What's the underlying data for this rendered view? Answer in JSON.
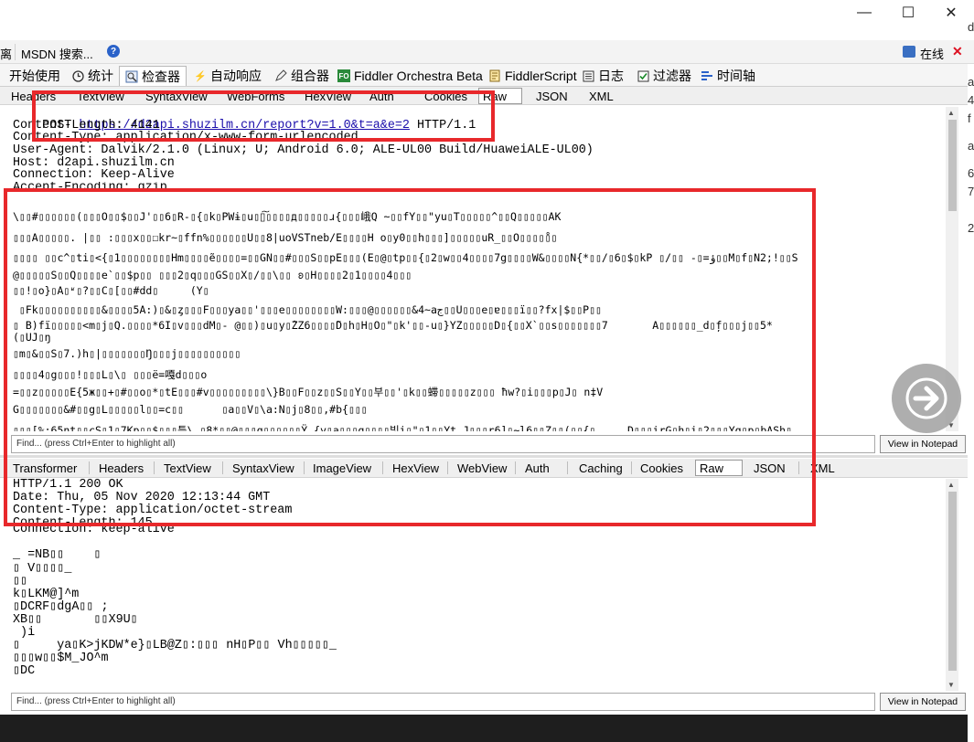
{
  "toolbar_top": {
    "left_label_1": "离",
    "search_label": "MSDN 搜索...",
    "help_icon": "help-circle-icon",
    "online_label": "在线",
    "close_x": "✕"
  },
  "window_controls": {
    "minimize": "—",
    "maximize": "☐",
    "close": "✕"
  },
  "right_edge_glyphs": [
    "d",
    "8",
    "a",
    "4",
    "f",
    "a",
    "6",
    "7",
    "2"
  ],
  "main_tabs": [
    {
      "label": "开始使用",
      "icon": ""
    },
    {
      "label": "统计",
      "icon": "clock-icon"
    },
    {
      "label": "检查器",
      "icon": "inspector-icon"
    },
    {
      "label": "自动响应",
      "icon": "lightning-icon"
    },
    {
      "label": "组合器",
      "icon": "compose-icon"
    },
    {
      "label": "Fiddler Orchestra Beta",
      "icon": "fo-icon"
    },
    {
      "label": "FiddlerScript",
      "icon": "script-icon"
    },
    {
      "label": "日志",
      "icon": "log-icon"
    },
    {
      "label": "过滤器",
      "icon": "filter-icon"
    },
    {
      "label": "时间轴",
      "icon": "timeline-icon"
    }
  ],
  "request_tabs": [
    "Headers",
    "TextView",
    "SyntaxView",
    "WebForms",
    "HexView",
    "Auth",
    "Cookies",
    "Raw",
    "JSON",
    "XML"
  ],
  "request_selected": "Raw",
  "request_headers": [
    {
      "prefix": "POST ",
      "url": "https://d2api.shuzilm.cn/report?v=1.0&t=a&e=2",
      "suffix": " HTTP/1.1"
    },
    {
      "text": "Content-Length: 4141"
    },
    {
      "text": "Content-Type: application/x-www-form-urlencoded"
    },
    {
      "text": "User-Agent: Dalvik/2.1.0 (Linux; U; Android 6.0; ALE-UL00 Build/HuaweiALE-UL00)"
    },
    {
      "text": "Host: d2api.shuzilm.cn"
    },
    {
      "text": "Connection: Keep-Alive"
    },
    {
      "text": "Accept-Encoding: gzip"
    }
  ],
  "request_body": [
    "\\▯▯#▯▯▯▯▯▯(▯▯▯O▯▯$▯▯J'▯▯6▯R-▯{▯k▯PWɨ▯u▯▯͠▯▯▯▯д▯▯▯▯▯ɹ{▯▯▯峨Q ~▯▯fY▯▯\"yu▯T▯▯▯▯▯^▯▯Q▯▯▯▯▯AK",
    "▯▯▯A▯▯▯▯▯. |▯▯ :▯▯▯x▯▯☐kr~▯ffn%▯▯▯▯▯▯U▯▯8|uoVSTneb/E▯▯▯▯H o▯y0▯▯h▯▯▯]▯▯▯▯▯uR_▯▯O▯▯▯▯̊▯▯",
    "▯▯▯▯ ▯▯c^▯ti▯<{▯1▯▯▯▯▯▯▯▯Hm▯▯▯▯ẽ▯▯▯▯=▯▯GN▯▯#▯▯▯S▯▯pE▯▯▯(E▯@▯tp▯▯{▯2▯w▯▯4▯▯▯▯7g▯▯▯▯W&▯▯▯▯N{*▯▯/▯6▯$▯kP ▯/▯▯ -▯=ؤ▯▯M▯f▯N2;!▯▯S",
    "@▯▯▯▯▯S▯▯Q▯▯▯▯e`▯▯$p▯▯ ▯▯▯2▯q▯▯▯GS▯▯X▯/▯▯\\▯▯ ʚ▯H▯▯▯▯2▯1▯▯▯▯4▯▯▯",
    "▯▯!▯o}▯A▯ʶ▯?▯▯C▯[▯▯#dd▯     (Y▯",
    " ▯Fk▯▯▯▯▯▯▯▯▯▯&▯▯▯▯5A:)▯&▯ȥ▯▯▯F▯▯▯ya▯▯'▯▯▯e▯▯▯▯▯▯▯▯W:▯▯▯@▯▯▯▯▯▯&4~aج▯▯U▯▯▯e▯ɐ▯▯▯ï▯▯?fx|$▯▯P▯▯",
    "▯ B)fï▯▯▯▯▯<m▯j▯Q.▯▯▯▯*6I▯v▯▯▯dM▯- @▯▯)▯u▯y▯̂ZZ6▯▯▯▯̃D▯h▯H▯O▯\"▯k'▯▯-u▯}YZ▯▯▯▯▯D▯{▯▯X`▯▯s▯▯▯▯▯▯▯7       A▯▯▯▯▯▯_d▯̦f▯▯▯j▯▯5*",
    "▯m▯&▯▯S▯7.)h▯|▯▯▯▯▯▯▯Ŋ▯▯▯j▯▯▯▯▯▯▯▯▯▯",
    "▯▯▯▯4▯g▯▯▯!▯▯▯L▯\\▯ ▯▯▯ë=嘎d▯▯▯o",
    "=▯▯z▯▯▯▯▯E{5ж▯▯+▯#▯▯o▯*▯tE▯▯▯#v▯▯▯▯▯▯▯▯▯\\}B▯▯F▯▯z▯▯S▯▯Y▯▯부▯▯'▯k▯▯䗖▯▯▯▯▯z▯▯▯ ħw?▯i▯▯▯p▯J▯ n‡V",
    "G▯▯▯▯▯▯▯&#▯▯g▯L▯▯▯▯▯l▯▯=c▯▯      ▯a▯▯V▯\\a:N▯j▯8▯▯,#b{▯▯▯",
    "▯▯▯[%:65nt▯▯cS▯1▯7Kp▯▯$▯▯▯틀\\ ▯8*▯▯@▯▯▯g▯▯▯▯▯▯Ÿ {y▯a▯▯▯g▯▯▯▯빛i▯\"▯1▯▯Yt J▯▯▯r6]▯~l6▯▯Z▯▯(▯▯{▯     D▯▯▯irG▯h▯i▯2▯▯▯Yq▯p▯bASh▯"
  ],
  "request_body_line7b": "(▯UJ▯ŋ",
  "find_placeholder": "Find... (press Ctrl+Enter to highlight all)",
  "view_in_notepad": "View in Notepad",
  "response_tabs": [
    "Transformer",
    "Headers",
    "TextView",
    "SyntaxView",
    "ImageView",
    "HexView",
    "WebView",
    "Auth",
    "Caching",
    "Cookies",
    "Raw",
    "JSON",
    "XML"
  ],
  "response_selected": "Raw",
  "response_lines": [
    "HTTP/1.1 200 OK",
    "Date: Thu, 05 Nov 2020 12:13:44 GMT",
    "Content-Type: application/octet-stream",
    "Content-Length: 145",
    "Connection: keep-alive",
    "",
    "_ =NB▯▯    ▯",
    "▯ V▯▯▯▯_",
    "▯▯",
    "k▯LKM@]^m",
    "▯DCRF▯dgA▯▯ ;",
    "XB▯▯       ▯▯X9U▯",
    " )i",
    "▯     ya▯K>jKDW*e}▯LB@Z▯:▯▯▯ nH▯P▯▯ Vh▯▯▯▯▯_",
    "▯▯▯w▯▯$M_JO^m",
    "▯DC"
  ],
  "accent_colors": {
    "red_highlight": "#e8282b",
    "link_blue": "#1a0dab"
  }
}
